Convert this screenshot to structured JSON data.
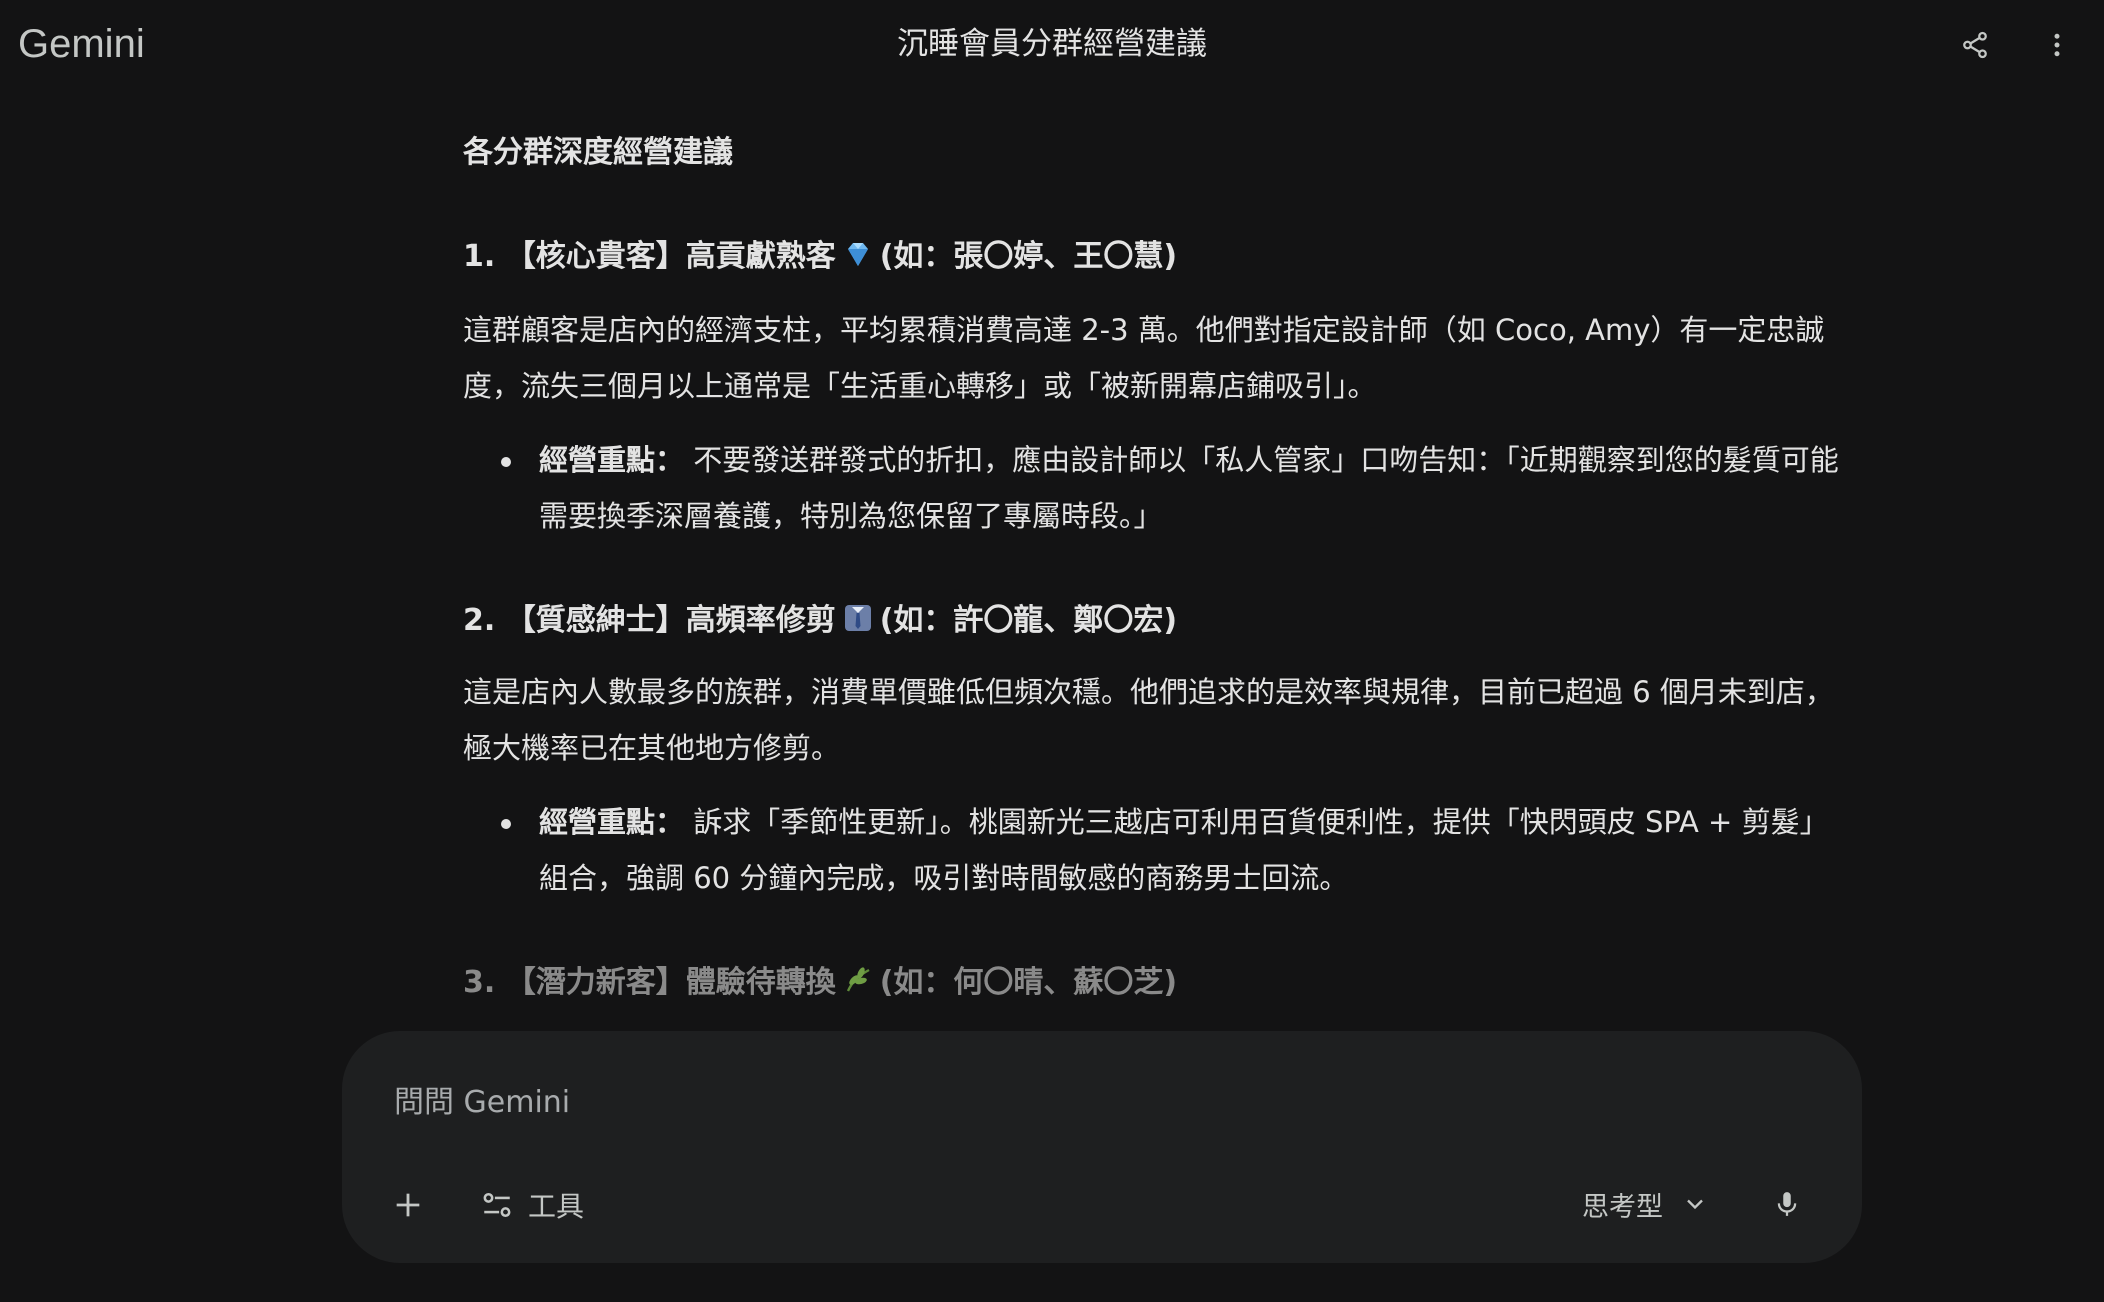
{
  "app": {
    "brand": "Gemini",
    "conversation_title": "沉睡會員分群經營建議"
  },
  "topbar": {
    "share_icon": "share-icon",
    "more_icon": "more-vert-icon"
  },
  "content": {
    "section_heading": "各分群深度經營建議",
    "segments": [
      {
        "heading_prefix": "1. 【核心貴客】高貢獻熟客",
        "emoji": "gem-emoji",
        "heading_suffix": "(如：張〇婷、王〇慧)",
        "paragraph": "這群顧客是店內的經濟支柱，平均累積消費高達 2-3 萬。他們對指定設計師（如 Coco, Amy）有一定忠誠度，流失三個月以上通常是「生活重心轉移」或「被新開幕店鋪吸引」。",
        "bullet_label": "經營重點：",
        "bullet_text": "不要發送群發式的折扣，應由設計師以「私人管家」口吻告知：「近期觀察到您的髮質可能需要換季深層養護，特別為您保留了專屬時段。」"
      },
      {
        "heading_prefix": "2. 【質感紳士】高頻率修剪",
        "emoji": "necktie-shirt-emoji",
        "heading_suffix": "(如：許〇龍、鄭〇宏)",
        "paragraph": "這是店內人數最多的族群，消費單價雖低但頻次穩。他們追求的是效率與規律，目前已超過 6 個月未到店，極大機率已在其他地方修剪。",
        "bullet_label": "經營重點：",
        "bullet_text": "訴求「季節性更新」。桃園新光三越店可利用百貨便利性，提供「快閃頭皮 SPA + 剪髮」組合，強調 60 分鐘內完成，吸引對時間敏感的商務男士回流。"
      },
      {
        "heading_prefix": "3. 【潛力新客】體驗待轉換",
        "emoji": "herb-emoji",
        "heading_suffix": "(如：何〇晴、蘇〇芝)"
      }
    ]
  },
  "composer": {
    "placeholder": "問問 Gemini",
    "tools_label": "工具",
    "model_label": "思考型",
    "plus_icon": "plus-icon",
    "tools_icon": "tune-icon",
    "chevron_icon": "chevron-down-icon",
    "mic_icon": "mic-icon"
  }
}
